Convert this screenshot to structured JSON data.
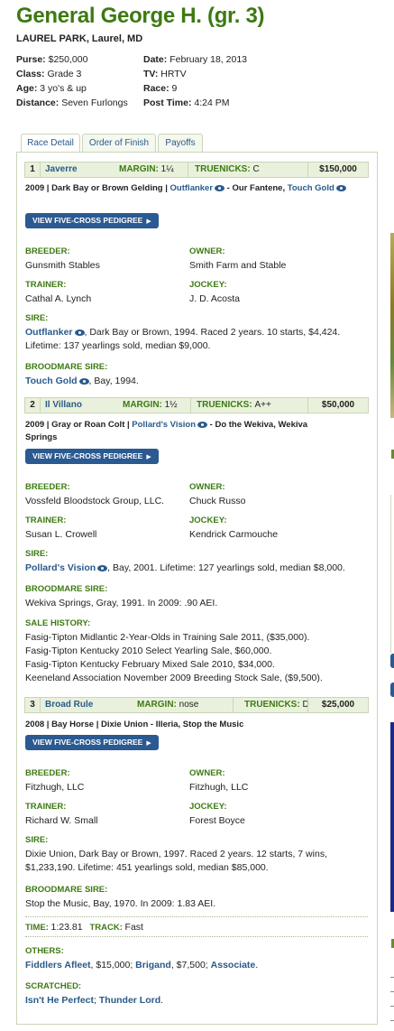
{
  "race": {
    "title": "General George H. (gr. 3)",
    "track": "LAUREL PARK, Laurel, MD",
    "info_left": [
      {
        "label": "Purse:",
        "value": "$250,000"
      },
      {
        "label": "Class:",
        "value": "Grade 3"
      },
      {
        "label": "Age:",
        "value": "3 yo's & up"
      },
      {
        "label": "Distance:",
        "value": "Seven Furlongs"
      }
    ],
    "info_right": [
      {
        "label": "Date:",
        "value": "February 18, 2013"
      },
      {
        "label": "TV:",
        "value": "HRTV"
      },
      {
        "label": "Race:",
        "value": "9"
      },
      {
        "label": "Post Time:",
        "value": "4:24 PM"
      }
    ]
  },
  "tabs": [
    {
      "label": "Race Detail",
      "active": true
    },
    {
      "label": "Order of Finish",
      "active": false
    },
    {
      "label": "Payoffs",
      "active": false
    }
  ],
  "labels": {
    "margin": "MARGIN:",
    "truenicks": "TRUENICKS:",
    "pedigree_button": "VIEW FIVE-CROSS PEDIGREE",
    "breeder": "BREEDER:",
    "owner": "OWNER:",
    "trainer": "TRAINER:",
    "jockey": "JOCKEY:",
    "sire": "SIRE:",
    "broodmare_sire": "BROODMARE SIRE:",
    "sale_history": "SALE HISTORY:",
    "time": "TIME:",
    "track": "TRACK:",
    "others": "OTHERS:",
    "scratched": "SCRATCHED:"
  },
  "horses": [
    {
      "pos": "1",
      "name": "Javerre",
      "margin": "1¼",
      "truenicks": "C",
      "purse": "$150,000",
      "desc_prefix": "2009 | Dark Bay or Brown Gelding | ",
      "desc_sire": "Outflanker",
      "desc_mid": " - Our Fantene, ",
      "desc_bms": "Touch Gold",
      "breeder": "Gunsmith Stables",
      "owner": "Smith Farm and Stable",
      "trainer": "Cathal A. Lynch",
      "jockey": "J. D. Acosta",
      "sire_name": "Outflanker",
      "sire_text_1": ", Dark Bay or Brown, 1994. Raced 2 years. 10 starts, $4,424.",
      "sire_text_2": "Lifetime: 137 yearlings sold, median $9,000.",
      "bms_name": "Touch Gold",
      "bms_text": ", Bay, 1994."
    },
    {
      "pos": "2",
      "name": "Il Villano",
      "margin": "1½",
      "truenicks": "A++",
      "purse": "$50,000",
      "desc_prefix": "2009 | Gray or Roan Colt | ",
      "desc_sire": "Pollard's Vision",
      "desc_mid": " - Do the Wekiva, Wekiva",
      "desc_line2": "Springs",
      "breeder": "Vossfeld Bloodstock Group, LLC.",
      "owner": "Chuck Russo",
      "trainer": "Susan L. Crowell",
      "jockey": "Kendrick Carmouche",
      "sire_name": "Pollard's Vision",
      "sire_text_1": ", Bay, 2001. Lifetime: 127 yearlings sold, median $8,000.",
      "bms_text": "Wekiva Springs, Gray, 1991. In 2009: .90 AEI.",
      "sale_history": [
        "Fasig-Tipton Midlantic 2-Year-Olds in Training Sale 2011, ($35,000).",
        "Fasig-Tipton Kentucky 2010 Select Yearling Sale, $60,000.",
        "Fasig-Tipton Kentucky February Mixed Sale 2010, $34,000.",
        "Keeneland Association November 2009 Breeding Stock Sale, ($9,500)."
      ]
    },
    {
      "pos": "3",
      "name": "Broad Rule",
      "margin": "nose",
      "truenicks": "D",
      "purse": "$25,000",
      "desc": "2008 | Bay Horse | Dixie Union - Illeria, Stop the Music",
      "breeder": "Fitzhugh, LLC",
      "owner": "Fitzhugh, LLC",
      "trainer": "Richard W. Small",
      "jockey": "Forest Boyce",
      "sire_text_1": "Dixie Union, Dark Bay or Brown, 1997. Raced 2 years. 12 starts, 7 wins,",
      "sire_text_2": "$1,233,190. Lifetime: 451 yearlings sold, median $85,000.",
      "bms_text": "Stop the Music, Bay, 1970. In 2009: 1.83 AEI."
    }
  ],
  "result": {
    "time": "1:23.81",
    "track": "Fast",
    "others": [
      {
        "name": "Fiddlers Afleet",
        "amount": ", $15,000; "
      },
      {
        "name": "Brigand",
        "amount": ", $7,500; "
      },
      {
        "name": "Associate",
        "amount": "."
      }
    ],
    "scratched": [
      {
        "name": "Isn't He Perfect",
        "sep": "; "
      },
      {
        "name": "Thunder Lord",
        "sep": "."
      }
    ]
  },
  "colors": {
    "title_green": "#3d7a12",
    "link_blue": "#2a5a8a",
    "button_blue": "#2b5a92",
    "bar_bg": "#e9f1dc",
    "border": "#c9d6b8"
  }
}
